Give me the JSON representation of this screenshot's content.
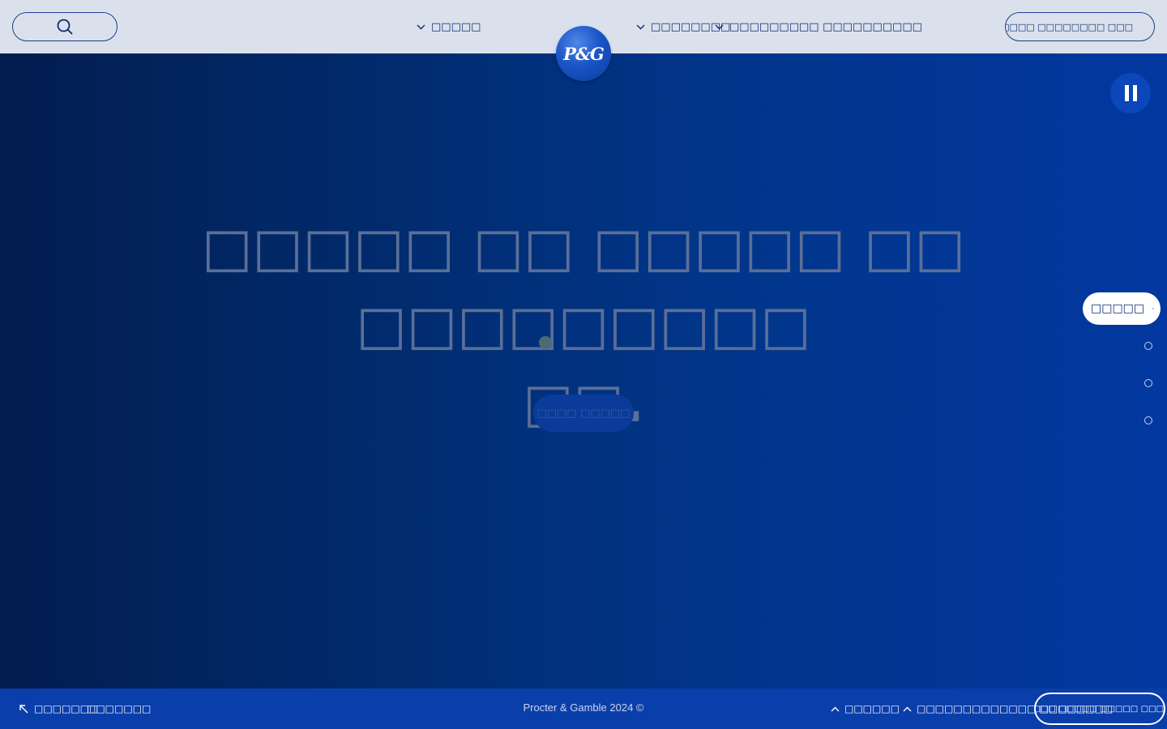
{
  "header": {
    "nav": [
      {
        "label": "□□□□□"
      },
      {
        "label": "□□□□□□□□"
      },
      {
        "label": "□□□□□□□□□ □□□□□□□□□□"
      }
    ],
    "language_label": "□□□□□□□ □□□□□□□□ □□□"
  },
  "logo": {
    "text": "P&G"
  },
  "hero": {
    "headline_line1": "□□□□□ □□ □□□□□ □□ □□□□□□□□□",
    "headline_line2": "□□",
    "cta_label": "□□□□ □□□□□"
  },
  "slides": {
    "active_label": "□□□□□",
    "total": 4,
    "active_index": 0
  },
  "footer": {
    "left_links": [
      "□□□□□□□",
      "□□□□□□□"
    ],
    "copyright": "Procter & Gamble 2024 ©",
    "right_links": [
      "□□□□□□",
      "□□□□□□□□□□□□□ □□□□□□□□"
    ],
    "button_label": "□□□□□□□□ □□□□□ □□□□□ □□□ □□□□□"
  },
  "colors": {
    "header_bg": "#dbe1ec",
    "nav_text": "#0b2a6f",
    "hero_dark": "#021d4f",
    "hero_light": "#0238a0",
    "footer_bg": "#0a3eaa",
    "brand_blue": "#1b55c7"
  },
  "icons": {
    "search": "search-icon",
    "globe": "globe-icon",
    "chevron": "chevron-down-icon",
    "pause": "pause-icon",
    "external": "external-link-icon"
  }
}
